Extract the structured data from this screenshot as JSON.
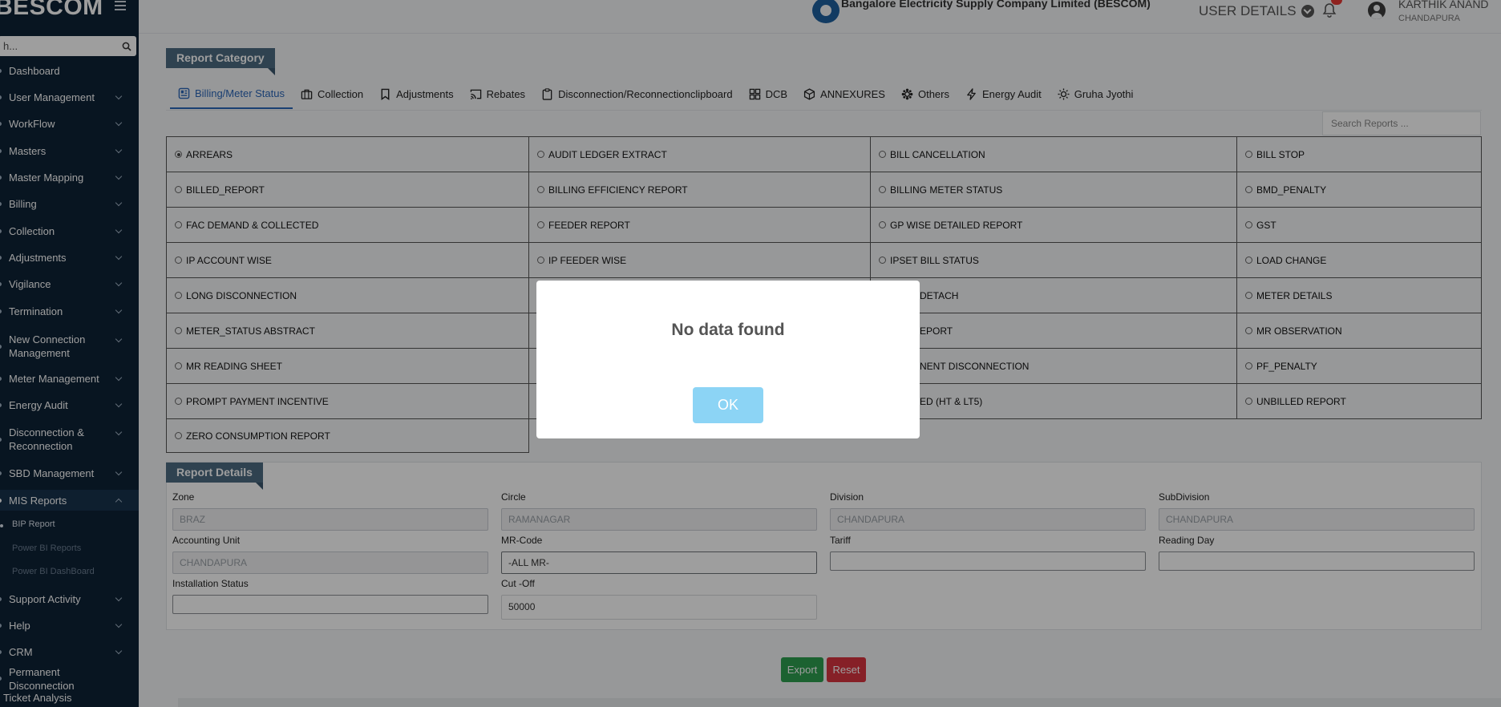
{
  "sidebar": {
    "brand": "BESCOM",
    "search_placeholder": "h...",
    "items": [
      {
        "label": "Dashboard",
        "chevron": false
      },
      {
        "label": "User Management",
        "chevron": true
      },
      {
        "label": "WorkFlow",
        "chevron": true
      },
      {
        "label": "Masters",
        "chevron": true
      },
      {
        "label": "Master Mapping",
        "chevron": true
      },
      {
        "label": "Billing",
        "chevron": true
      },
      {
        "label": "Collection",
        "chevron": true
      },
      {
        "label": "Adjustments",
        "chevron": true
      },
      {
        "label": "Vigilance",
        "chevron": true
      },
      {
        "label": "Termination",
        "chevron": true
      },
      {
        "label": "New Connection Management",
        "chevron": true
      },
      {
        "label": "Meter Management",
        "chevron": true
      },
      {
        "label": "Energy Audit",
        "chevron": true
      },
      {
        "label": "Disconnection & Reconnection",
        "chevron": true
      },
      {
        "label": "SBD Management",
        "chevron": true
      },
      {
        "label": "MIS Reports",
        "chevron": true,
        "expanded": true
      },
      {
        "label": "Support Activity",
        "chevron": true
      },
      {
        "label": "Help",
        "chevron": true
      },
      {
        "label": "CRM",
        "chevron": true
      },
      {
        "label": "Permanent Disconnection",
        "chevron": false
      },
      {
        "label": "Ticket Analysis Dashboard",
        "chevron": false
      }
    ],
    "mis_sub": [
      "BIP Report",
      "Power BI Reports",
      "Power BI DashBoard"
    ]
  },
  "header": {
    "company": "Bangalore Electricity Supply Company Limited (BESCOM)",
    "user_details": "USER DETAILS",
    "user_name": "KARTHIK ANAND",
    "user_location": "CHANDAPURA"
  },
  "report_category": {
    "title": "Report Category",
    "tabs": [
      {
        "label": "Billing/Meter Status",
        "icon": "grid-card-icon",
        "active": true
      },
      {
        "label": "Collection",
        "icon": "briefcase-icon"
      },
      {
        "label": "Adjustments",
        "icon": "bookmark-icon"
      },
      {
        "label": "Rebates",
        "icon": "cast-icon"
      },
      {
        "label": "Disconnection/Reconnectionclipboard",
        "icon": "clipboard-icon"
      },
      {
        "label": "DCB",
        "icon": "grid-icon"
      },
      {
        "label": "ANNEXURES",
        "icon": "box-icon"
      },
      {
        "label": "Others",
        "icon": "gear-cluster-icon"
      },
      {
        "label": "Energy Audit",
        "icon": "lightning-icon"
      },
      {
        "label": "Gruha Jyothi",
        "icon": "sun-icon"
      }
    ],
    "search_placeholder": "Search Reports ...",
    "reports": [
      [
        "ARREARS",
        "AUDIT LEDGER EXTRACT",
        "BILL CANCELLATION",
        "BILL STOP"
      ],
      [
        "BILLED_REPORT",
        "BILLING EFFICIENCY REPORT",
        "BILLING METER STATUS",
        "BMD_PENALTY"
      ],
      [
        "FAC DEMAND & COLLECTED",
        "FEEDER REPORT",
        "GP WISE DETAILED REPORT",
        "GST"
      ],
      [
        "IP ACCOUNT WISE",
        "IP FEEDER WISE",
        "IPSET BILL STATUS",
        "LOAD CHANGE"
      ],
      [
        "LONG DISCONNECTION",
        "",
        "DETACH",
        "METER DETAILS"
      ],
      [
        "METER_STATUS ABSTRACT",
        "",
        "EPORT",
        "MR OBSERVATION"
      ],
      [
        "MR READING SHEET",
        "",
        "NENT DISCONNECTION",
        "PF_PENALTY"
      ],
      [
        "PROMPT PAYMENT INCENTIVE",
        "",
        "ED (HT & LT5)",
        "UNBILLED REPORT"
      ],
      [
        "ZERO CONSUMPTION REPORT"
      ]
    ]
  },
  "report_details": {
    "title": "Report Details",
    "fields": [
      {
        "label": "Zone",
        "value": "BRAZ"
      },
      {
        "label": "Circle",
        "value": "RAMANAGAR"
      },
      {
        "label": "Division",
        "value": "CHANDAPURA"
      },
      {
        "label": "SubDivision",
        "value": "CHANDAPURA"
      },
      {
        "label": "Accounting Unit",
        "value": "CHANDAPURA"
      },
      {
        "label": "MR-Code",
        "value": "-ALL MR-"
      },
      {
        "label": "Tariff",
        "value": ""
      },
      {
        "label": "Reading Day",
        "value": ""
      },
      {
        "label": "Installation Status",
        "value": ""
      },
      {
        "label": "Cut -Off",
        "value": "50000"
      }
    ],
    "export_label": "Export",
    "reset_label": "Reset"
  },
  "modal": {
    "title": "No data found",
    "ok_label": "OK"
  },
  "colors": {
    "sidebar": "#0e2236",
    "accent": "#2a66b8",
    "tag": "#4d6b82",
    "export": "#2e9e4f",
    "reset": "#d9343f",
    "ok": "#8cd4f5"
  }
}
